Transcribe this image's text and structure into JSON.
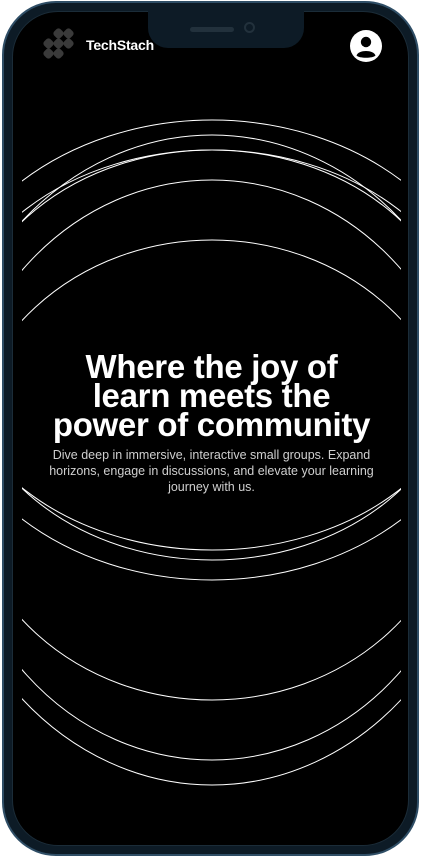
{
  "header": {
    "brand_name": "TechStach",
    "logo_icon": "techstach-logo-icon",
    "profile_icon": "user-profile-icon"
  },
  "hero": {
    "title_line1": "Where the joy of",
    "title_line2": "learn meets the",
    "title_line3": "power of community",
    "subtitle": "Dive deep in immersive, interactive small groups. Expand horizons, engage in discussions, and elevate your learning journey with us."
  },
  "colors": {
    "background": "#000000",
    "text": "#ffffff",
    "subtitle_text": "#cfcfcf",
    "ring_stroke": "#ffffff",
    "frame": "#0d1b26",
    "frame_border": "#2f4e66"
  }
}
